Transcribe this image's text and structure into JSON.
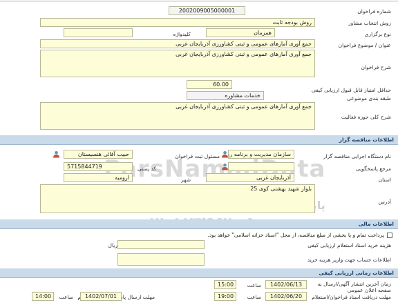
{
  "form": {
    "tender_number_label": "شماره فراخوان",
    "tender_number": "2002009005000001",
    "consultant_method_label": "روش انتخاب مشاور",
    "consultant_method": "روش بودجه ثابت",
    "holding_type_label": "نوع برگزاری",
    "holding_type": "همزمان",
    "keyword_label": "کلیدواژه",
    "keyword": "",
    "title_label": "عنوان / موضوع فراخوان",
    "title": "جمع آوری آمارهای عمومی و ثبتی کشاورزی آذربایجان غربی",
    "description_label": "شرح فراخوان",
    "description": "جمع آوری آمارهای عمومی و ثبتی کشاورزی آذربایجان غربی",
    "min_score_label": "حداقل امتیاز قابل قبول ارزیابی کیفی",
    "min_score": "60.00",
    "category_label": "طبقه بندی موضوعی",
    "category": "خدمات مشاوره",
    "activity_label": "شرح کلی حوزه فعالیت",
    "activity": "جمع آوری آمارهای عمومی و ثبتی کشاورزی آذربایجان غربی"
  },
  "organizer": {
    "section_title": "اطلاعات مناقصه گزار",
    "agency_label": "نام دستگاه اجرایی مناقصه گزار",
    "agency": "سازمان مدیریت و برنامه ریزی",
    "registrar_label": "مسئول ثبت فراخوان",
    "registrar": "حبیب آقائی هنسیستان",
    "reference_label": "مرجع پاسخگویی",
    "reference": "",
    "postal_label": "کد پستی",
    "postal": "5715844719",
    "province_label": "استان",
    "province": "آذربایجان غربی",
    "city_label": "شهر",
    "city": "ارومیه",
    "address_label": "آدرس",
    "address": "بلوار شهید بهشتی کوی 25"
  },
  "financial": {
    "section_title": "اطلاعات مالی",
    "treasury_text": "پرداخت تمام و یا بخشی از مبلغ مناقصه، از محل \"اسناد خزانه اسلامی\" خواهد بود.",
    "fee_label": "هزینه خرید اسناد استعلام ارزیابی کیفی",
    "fee_unit": "ریال",
    "fee": "",
    "account_label": "اطلاعات حساب جهت واریز هزینه خرید"
  },
  "timing": {
    "section_title": "اطلاعات زمانی ارزیابی کیفی",
    "publish_label": "زمان آخرین انتشار آگهی/ارسال به صفحه اعلان عمومی",
    "publish_date": "1402/06/13",
    "publish_time_label": "ساعت",
    "publish_time": "15:00",
    "receive_label": "مهلت دریافت اسناد فراخوان/استعلام",
    "receive_date": "1402/06/20",
    "receive_time_label": "ساعت",
    "receive_time": "19:00",
    "response_label": "مهلت ارسال پاسخ فراخوان/استعلام",
    "response_date": "1402/07/01",
    "response_time_label": "ساعت",
    "response_time": "14:00"
  },
  "watermark": {
    "brand": "ParsNamadData",
    "line1": "اطلاعات پارس نماد داده",
    "line2": "پایگاه اطلاع رسانی مناقصه و مزایده",
    "phone": "۰۲۱-۸۸۳۴۹۶۷۰-۵"
  },
  "colors": {
    "field_bg": "#fdfdd8",
    "section_bg": "#c9daeb",
    "watermark": "#cfcfcf"
  }
}
